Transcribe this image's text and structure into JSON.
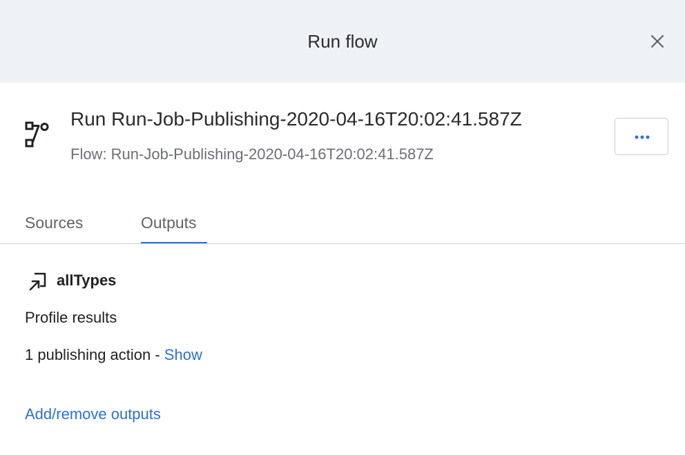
{
  "header": {
    "title": "Run flow",
    "close_icon": "close-icon"
  },
  "run": {
    "title": "Run Run-Job-Publishing-2020-04-16T20:02:41.587Z",
    "subtitle": "Flow: Run-Job-Publishing-2020-04-16T20:02:41.587Z",
    "icon": "flow-icon",
    "more_icon": "more-horizontal-icon"
  },
  "tabs": [
    {
      "label": "Sources",
      "active": false
    },
    {
      "label": "Outputs",
      "active": true
    }
  ],
  "output": {
    "icon": "output-arrow-icon",
    "name": "allTypes",
    "profile_results": "Profile results",
    "publishing_text": "1 publishing action - ",
    "show_link": "Show"
  },
  "add_remove_link": "Add/remove outputs",
  "colors": {
    "header_bg": "#eef2f6",
    "accent": "#2c6fd8",
    "muted_text": "#6b6f76",
    "divider": "#c7d3e3"
  }
}
